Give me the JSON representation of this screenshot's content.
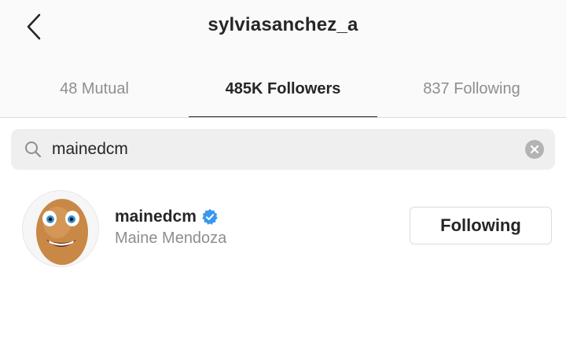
{
  "header": {
    "back_icon": "chevron-left-icon",
    "title": "sylviasanchez_a"
  },
  "tabs": [
    {
      "label": "48 Mutual",
      "active": false
    },
    {
      "label": "485K Followers",
      "active": true
    },
    {
      "label": "837 Following",
      "active": false
    }
  ],
  "search": {
    "icon": "search-icon",
    "value": "mainedcm",
    "clear_icon": "clear-icon"
  },
  "results": [
    {
      "username": "mainedcm",
      "verified": true,
      "full_name": "Maine Mendoza",
      "button_label": "Following"
    }
  ],
  "colors": {
    "text_primary": "#262626",
    "text_secondary": "#8e8e8e",
    "verified_blue": "#3897f0",
    "search_bg": "#efefef",
    "header_bg": "#fafafa"
  }
}
